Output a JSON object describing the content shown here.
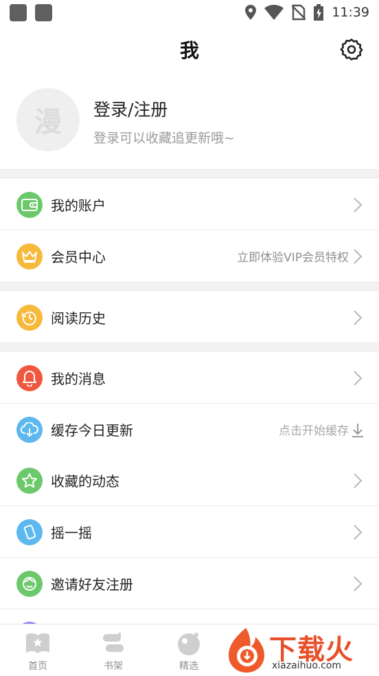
{
  "status_bar": {
    "time": "11:39"
  },
  "header": {
    "title": "我"
  },
  "profile": {
    "avatar_char": "漫",
    "login_label": "登录/注册",
    "login_hint": "登录可以收藏追更新哦~"
  },
  "menu": {
    "account": {
      "label": "我的账户",
      "color": "#6cc96b"
    },
    "vip": {
      "label": "会员中心",
      "hint": "立即体验VIP会员特权",
      "color": "#f6b93b"
    },
    "history": {
      "label": "阅读历史",
      "color": "#f6b93b"
    },
    "messages": {
      "label": "我的消息",
      "color": "#f0573f"
    },
    "cache": {
      "label": "缓存今日更新",
      "hint": "点击开始缓存",
      "color": "#5cb8ee"
    },
    "favorites": {
      "label": "收藏的动态",
      "color": "#6cc96b"
    },
    "shake": {
      "label": "摇一摇",
      "color": "#5cb8ee"
    },
    "invite": {
      "label": "邀请好友注册",
      "color": "#6cc96b"
    }
  },
  "tabs": {
    "home": "首页",
    "shelf": "书架",
    "featured": "精选"
  },
  "watermark": {
    "brand": "下载火",
    "site": "xiazaihuo.com"
  }
}
